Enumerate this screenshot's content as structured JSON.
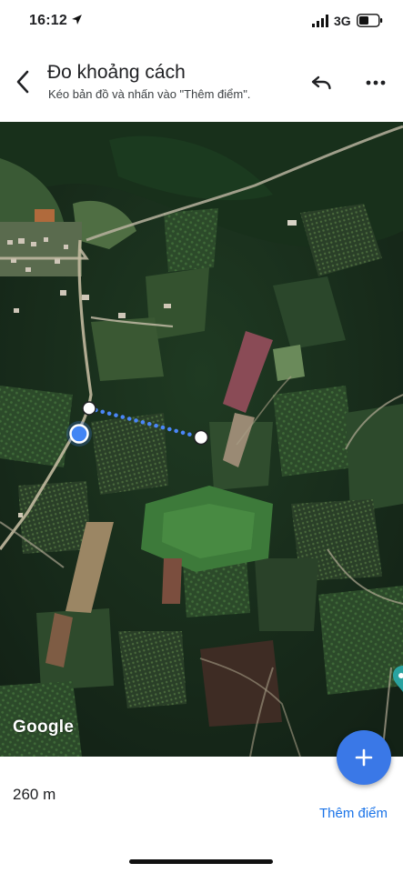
{
  "status_bar": {
    "time": "16:12",
    "network": "3G"
  },
  "header": {
    "title": "Đo khoảng cách",
    "subtitle": "Kéo bản đồ và nhấn vào \"Thêm điểm\".",
    "back_icon": "chevron-left-icon",
    "undo_icon": "undo-icon",
    "more_icon": "more-horizontal-icon"
  },
  "map": {
    "logo_text": "Google",
    "measure_line_color": "#4a86f7",
    "location_dot_color": "#4285f4"
  },
  "bottom": {
    "distance": "260 m",
    "add_point_label": "Thêm điểm",
    "fab_icon": "plus-icon",
    "accent": "#1a73e8"
  }
}
